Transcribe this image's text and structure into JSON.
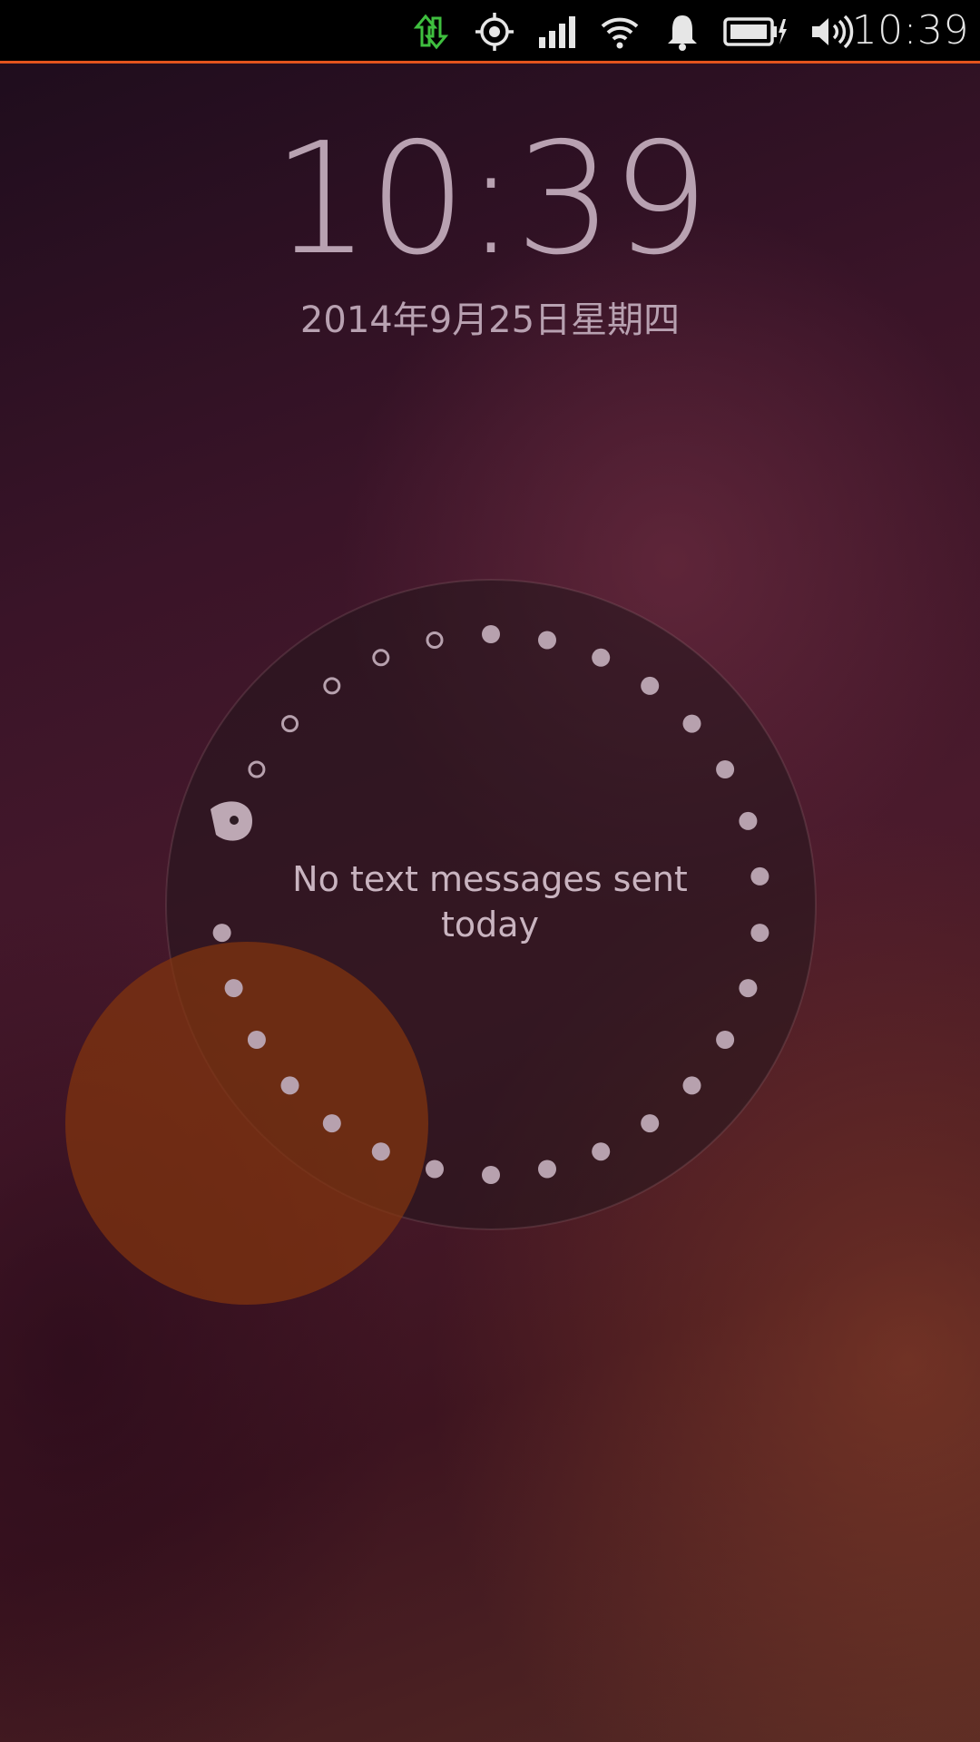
{
  "status_bar": {
    "icons": [
      "data-transfer-icon",
      "location-icon",
      "cellular-signal-icon",
      "wifi-icon",
      "notification-bell-icon",
      "battery-charging-icon",
      "volume-icon"
    ],
    "data_icon_color": "#3fbf3f",
    "accent_color": "#e2541d",
    "time": "10:39"
  },
  "lockscreen": {
    "time": "10:39",
    "date": "2014年9月25日星期四"
  },
  "infographic": {
    "message": "No text messages sent today",
    "message_line1": "No text messages sent",
    "message_line2": "today",
    "circle_color": "#2e1c24",
    "accent_circle_color": "#7a2f12",
    "dots_total": 30,
    "dots_hollow": 6,
    "dots_filled": 23
  }
}
